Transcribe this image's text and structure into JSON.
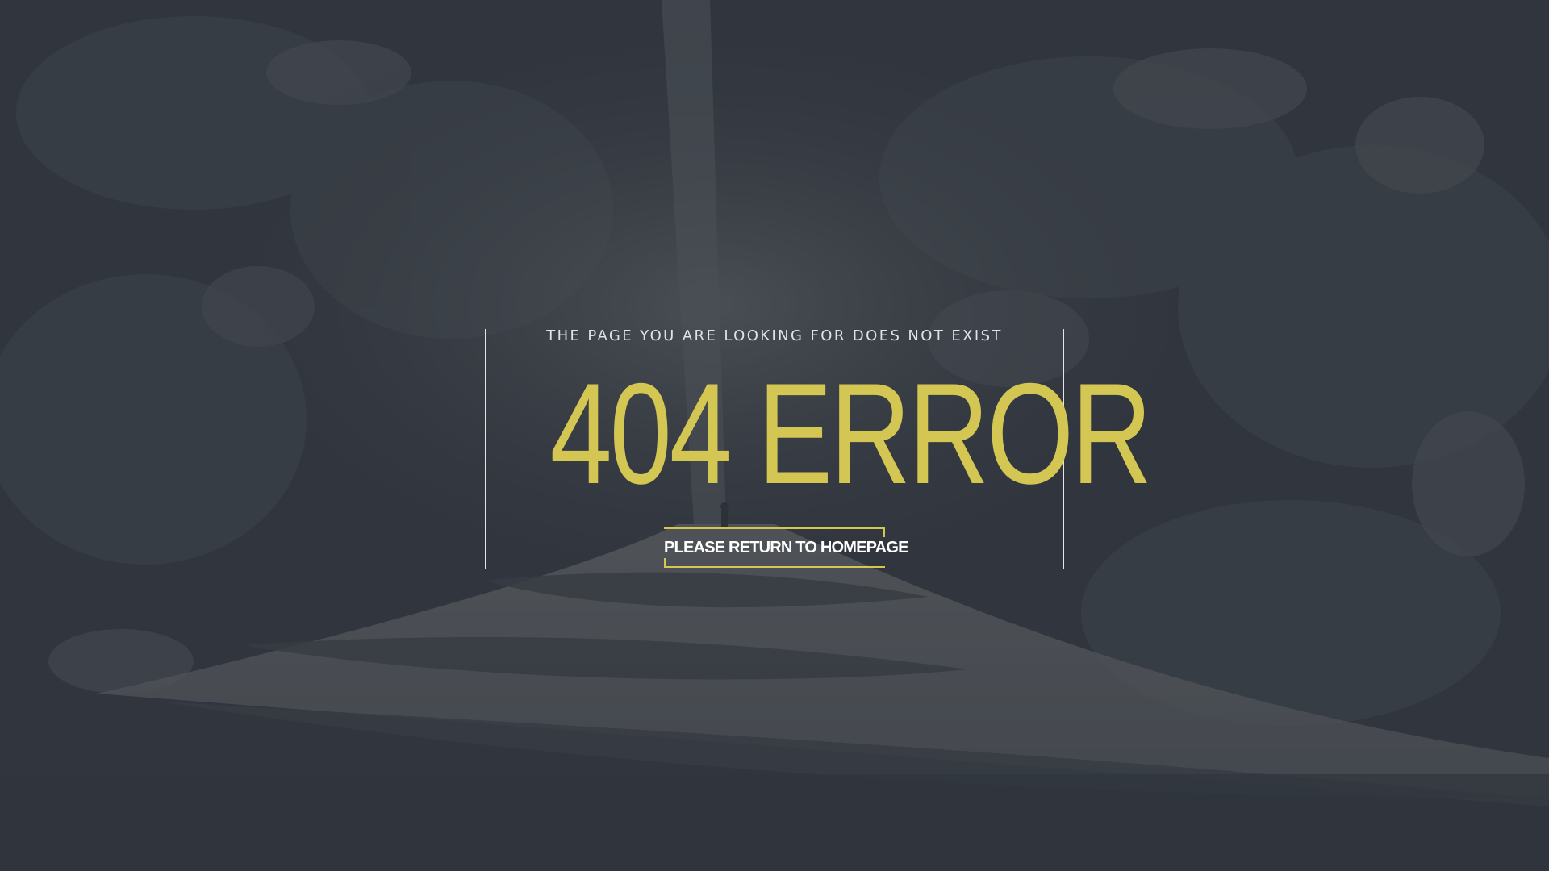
{
  "background": {
    "description_icon": "forest-road-photo",
    "overlay_color": "#343841"
  },
  "error": {
    "subtitle": "THE PAGE YOU ARE LOOKING FOR DOES NOT EXIST",
    "headline": "404 ERROR",
    "headline_color": "#d4c653"
  },
  "cta": {
    "label": "PLEASE RETURN TO HOMEPAGE",
    "accent_color": "#d4c653"
  }
}
